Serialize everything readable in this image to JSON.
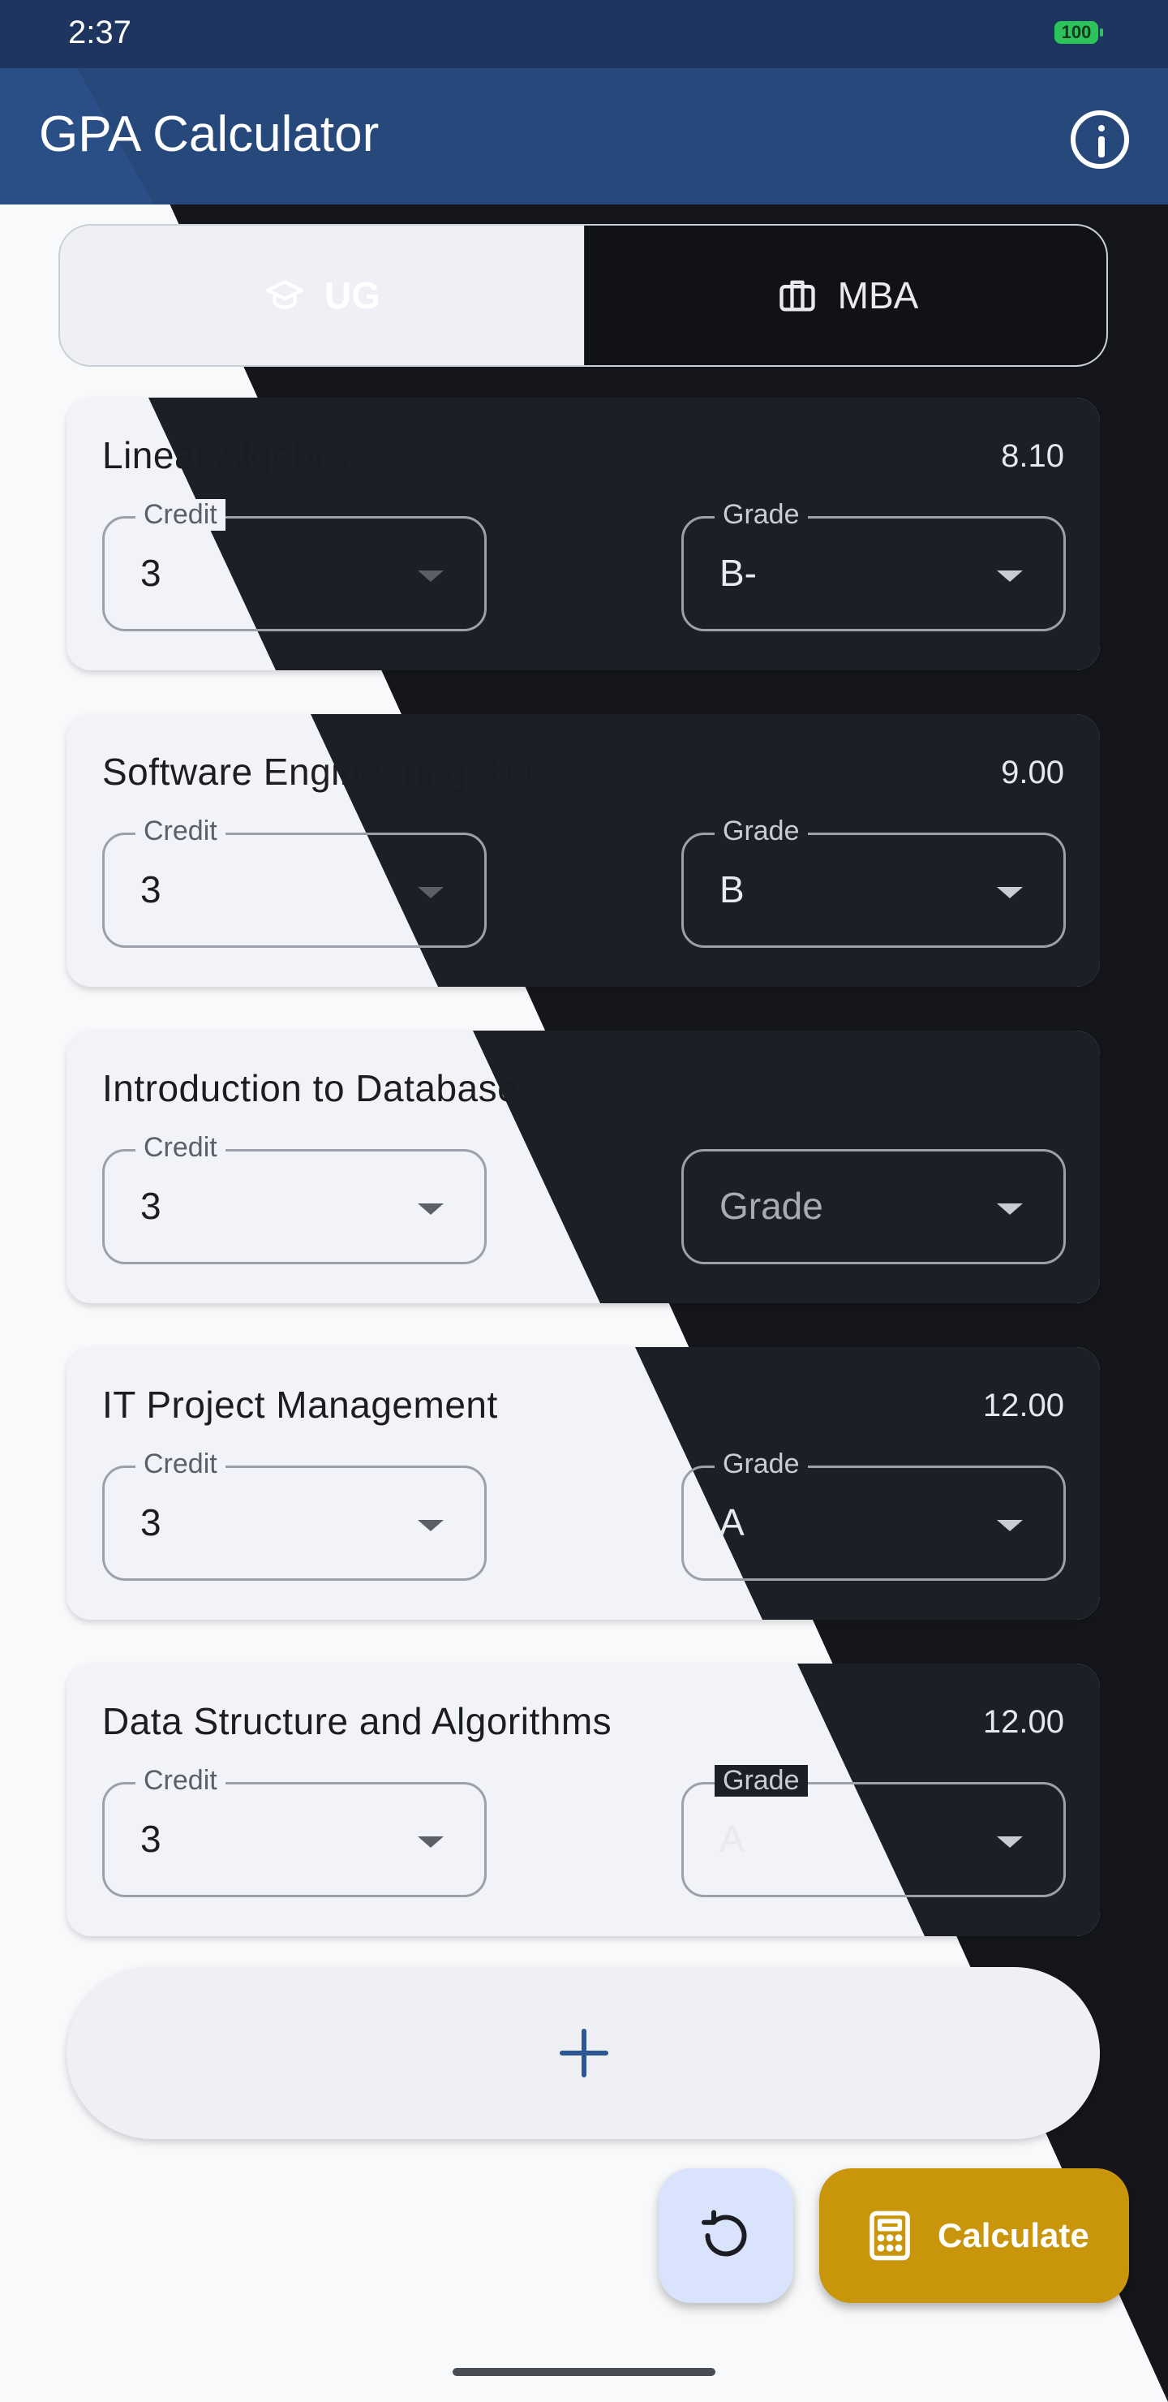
{
  "status_bar": {
    "time": "2:37",
    "battery": "100"
  },
  "app_bar": {
    "title": "GPA Calculator"
  },
  "segments": {
    "ug": "UG",
    "mba": "MBA"
  },
  "courses": [
    {
      "name": "Linear Algebra",
      "points": "8.10",
      "credit_label": "Credit",
      "credit": "3",
      "grade_label": "Grade",
      "grade": "B-"
    },
    {
      "name": "Software Engineering 311",
      "points": "9.00",
      "credit_label": "Credit",
      "credit": "3",
      "grade_label": "Grade",
      "grade": "B"
    },
    {
      "name": "Introduction to Database",
      "points": "",
      "credit_label": "Credit",
      "credit": "3",
      "grade_label": "",
      "grade": "Grade"
    },
    {
      "name": "IT Project Management",
      "points": "12.00",
      "credit_label": "Credit",
      "credit": "3",
      "grade_label": "Grade",
      "grade": "A"
    },
    {
      "name": "Data Structure and Algorithms",
      "points": "12.00",
      "credit_label": "Credit",
      "credit": "3",
      "grade_label": "Grade",
      "grade": "A"
    }
  ],
  "actions": {
    "calculate": "Calculate"
  },
  "colors": {
    "primary": "#2a4f86",
    "accent": "#c8950b",
    "reset_bg": "#d9e3fb",
    "dark_bg": "#14161b"
  }
}
